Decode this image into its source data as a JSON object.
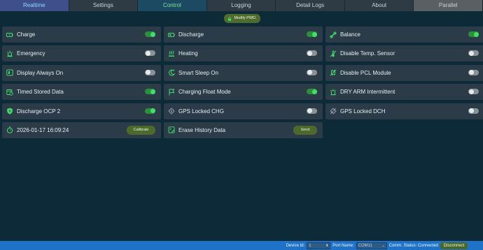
{
  "tabs": [
    {
      "label": "Realtime"
    },
    {
      "label": "Settings"
    },
    {
      "label": "Control"
    },
    {
      "label": "Logging"
    },
    {
      "label": "Detail Logs"
    },
    {
      "label": "About"
    },
    {
      "label": "Parallel"
    }
  ],
  "active_tab": "Control",
  "modify_pwd_label": "Modify PWD.",
  "controls": [
    {
      "label": "Charge",
      "icon": "battery-charge-icon",
      "state": "on"
    },
    {
      "label": "Discharge",
      "icon": "battery-discharge-icon",
      "state": "on"
    },
    {
      "label": "Balance",
      "icon": "balance-icon",
      "state": "on"
    },
    {
      "label": "Emergency",
      "icon": "siren-icon",
      "state": "off"
    },
    {
      "label": "Heating",
      "icon": "heating-icon",
      "state": "off"
    },
    {
      "label": "Disable Temp. Sensor",
      "icon": "thermometer-off-icon",
      "state": "off"
    },
    {
      "label": "Display Always On",
      "icon": "display-icon",
      "state": "off"
    },
    {
      "label": "Smart Sleep On",
      "icon": "moon-icon",
      "state": "off"
    },
    {
      "label": "Disable PCL Module",
      "icon": "module-off-icon",
      "state": "off"
    },
    {
      "label": "Timed Stored Data",
      "icon": "calendar-clock-icon",
      "state": "on"
    },
    {
      "label": "Charging Float Mode",
      "icon": "float-flag-icon",
      "state": "on"
    },
    {
      "label": "DRY ARM Intermittent",
      "icon": "alarm-icon",
      "state": "off"
    },
    {
      "label": "Discharge OCP 2",
      "icon": "shield-bolt-icon",
      "state": "on"
    },
    {
      "label": "GPS Locked CHG",
      "icon": "gps-icon",
      "state": "off"
    },
    {
      "label": "GPS Locked DCH",
      "icon": "gps-off-icon",
      "state": "off"
    }
  ],
  "datetime_card": {
    "label": "2026-01-17 16:09:24",
    "icon": "stopwatch-icon",
    "button": "Calibrate"
  },
  "erase_card": {
    "label": "Erase History Data",
    "icon": "erase-icon",
    "button": "Send"
  },
  "status": {
    "device_id_label": "Device Id:",
    "device_id_value": "1",
    "port_name_label": "Port Name:",
    "port_name_value": "COM11",
    "comm_status": "Comm. Status: Connected",
    "disconnect_label": "Disconnect"
  },
  "colors": {
    "accent_green": "#3fe06a",
    "toggle_off": "#8a9298",
    "statusbar": "#1e73c8",
    "background": "#0d2a38"
  }
}
